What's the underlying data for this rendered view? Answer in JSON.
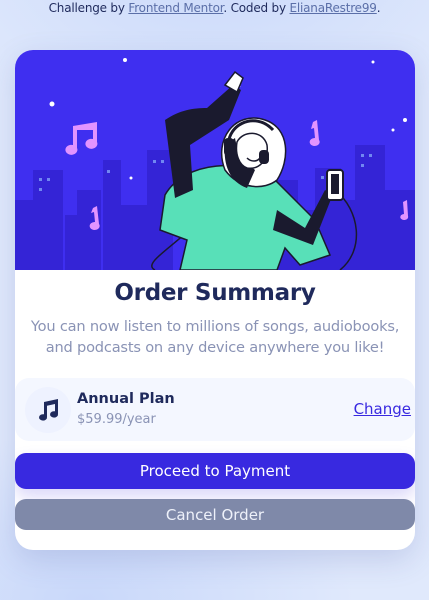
{
  "attribution": {
    "prefix": "Challenge by ",
    "challenge_link": "Frontend Mentor",
    "middle": ". Coded by ",
    "author_link": "ElianaRestre99",
    "suffix": "."
  },
  "card": {
    "title": "Order Summary",
    "description": "You can now listen to millions of songs, audiobooks, and podcasts on any device anywhere you like!",
    "plan": {
      "icon": "music-note-icon",
      "name": "Annual Plan",
      "price": "$59.99/year",
      "change_label": "Change"
    },
    "proceed_label": "Proceed to Payment",
    "cancel_label": "Cancel Order"
  },
  "colors": {
    "hero_bg": "#3f2ff0",
    "primary": "#3829e0",
    "title": "#1f2a5c",
    "muted": "#8a93b5",
    "cancel_bg": "#7f89a9",
    "page_bg": "#e0e9fc"
  }
}
